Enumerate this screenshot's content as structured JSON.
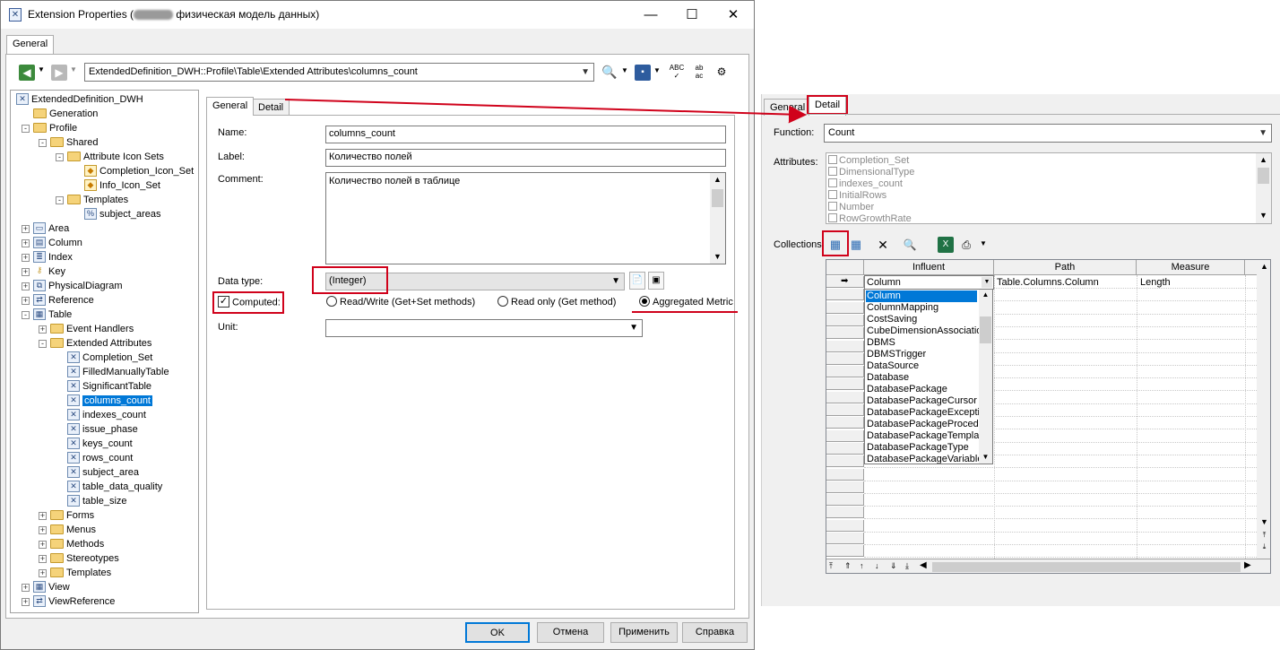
{
  "window": {
    "title": "Extension Properties (",
    "title_suffix": "физическая модель данных)",
    "min_glyph": "—",
    "max_glyph": "☐",
    "close_glyph": "✕"
  },
  "outer_tab": "General",
  "path_combo": "ExtendedDefinition_DWH::Profile\\Table\\Extended Attributes\\columns_count",
  "tree": [
    {
      "label": "ExtendedDefinition_DWH",
      "icon": "xem-icon"
    },
    {
      "label": "Generation",
      "icon": "folder-icon"
    },
    {
      "label": "Profile",
      "icon": "folder-icon"
    },
    {
      "label": "Shared",
      "icon": "folder-icon"
    },
    {
      "label": "Attribute Icon Sets",
      "icon": "folder-icon"
    },
    {
      "label": "Completion_Icon_Set",
      "icon": "icon-set-icon"
    },
    {
      "label": "Info_Icon_Set",
      "icon": "icon-set-icon"
    },
    {
      "label": "Templates",
      "icon": "folder-icon"
    },
    {
      "label": "subject_areas",
      "icon": "template-icon"
    },
    {
      "label": "Area",
      "icon": "area-icon"
    },
    {
      "label": "Column",
      "icon": "column-icon"
    },
    {
      "label": "Index",
      "icon": "index-icon"
    },
    {
      "label": "Key",
      "icon": "key-icon"
    },
    {
      "label": "PhysicalDiagram",
      "icon": "diagram-icon"
    },
    {
      "label": "Reference",
      "icon": "reference-icon"
    },
    {
      "label": "Table",
      "icon": "table-icon"
    },
    {
      "label": "Event Handlers",
      "icon": "folder-icon"
    },
    {
      "label": "Extended Attributes",
      "icon": "folder-icon"
    },
    {
      "label": "Completion_Set",
      "icon": "attr-icon"
    },
    {
      "label": "FilledManuallyTable",
      "icon": "attr-icon"
    },
    {
      "label": "SignificantTable",
      "icon": "attr-icon"
    },
    {
      "label": "columns_count",
      "icon": "attr-icon"
    },
    {
      "label": "indexes_count",
      "icon": "attr-icon"
    },
    {
      "label": "issue_phase",
      "icon": "attr-icon"
    },
    {
      "label": "keys_count",
      "icon": "attr-icon"
    },
    {
      "label": "rows_count",
      "icon": "attr-icon"
    },
    {
      "label": "subject_area",
      "icon": "attr-icon"
    },
    {
      "label": "table_data_quality",
      "icon": "attr-icon"
    },
    {
      "label": "table_size",
      "icon": "attr-icon"
    },
    {
      "label": "Forms",
      "icon": "folder-icon"
    },
    {
      "label": "Menus",
      "icon": "folder-icon"
    },
    {
      "label": "Methods",
      "icon": "folder-icon"
    },
    {
      "label": "Stereotypes",
      "icon": "folder-icon"
    },
    {
      "label": "Templates",
      "icon": "folder-icon"
    },
    {
      "label": "View",
      "icon": "view-icon"
    },
    {
      "label": "ViewReference",
      "icon": "reference-icon"
    }
  ],
  "form": {
    "tab_general": "General",
    "tab_detail": "Detail",
    "name_label": "Name:",
    "name_value": "columns_count",
    "label_label": "Label:",
    "label_value": "Количество полей",
    "comment_label": "Comment:",
    "comment_value": "Количество полей в таблице",
    "datatype_label": "Data type:",
    "datatype_value": "(Integer)",
    "computed_label": "Computed:",
    "radio_rw": "Read/Write (Get+Set methods)",
    "radio_ro": "Read only (Get method)",
    "radio_agg": "Aggregated Metric",
    "unit_label": "Unit:",
    "unit_value": ""
  },
  "buttons": {
    "ok": "OK",
    "cancel": "Отмена",
    "apply": "Применить",
    "help": "Справка"
  },
  "detail": {
    "tab_general": "General",
    "tab_detail": "Detail",
    "function_label": "Function:",
    "function_value": "Count",
    "attributes_label": "Attributes:",
    "attributes": [
      "Completion_Set",
      "DimensionalType",
      "indexes_count",
      "InitialRows",
      "Number",
      "RowGrowthRate"
    ],
    "collections_label": "Collections:",
    "grid_headers": [
      "Influent",
      "Path",
      "Measure"
    ],
    "grid_row": {
      "influent": "Column",
      "path": "Table.Columns.Column",
      "measure": "Length"
    },
    "dropdown_items": [
      "Column",
      "ColumnMapping",
      "CostSaving",
      "CubeDimensionAssociation",
      "DBMS",
      "DBMSTrigger",
      "DataSource",
      "Database",
      "DatabasePackage",
      "DatabasePackageCursor",
      "DatabasePackageException",
      "DatabasePackageProcedure",
      "DatabasePackageTemplate",
      "DatabasePackageType",
      "DatabasePackageVariable"
    ]
  },
  "colors": {
    "highlight": "#d0021b",
    "selection": "#0078d7"
  }
}
